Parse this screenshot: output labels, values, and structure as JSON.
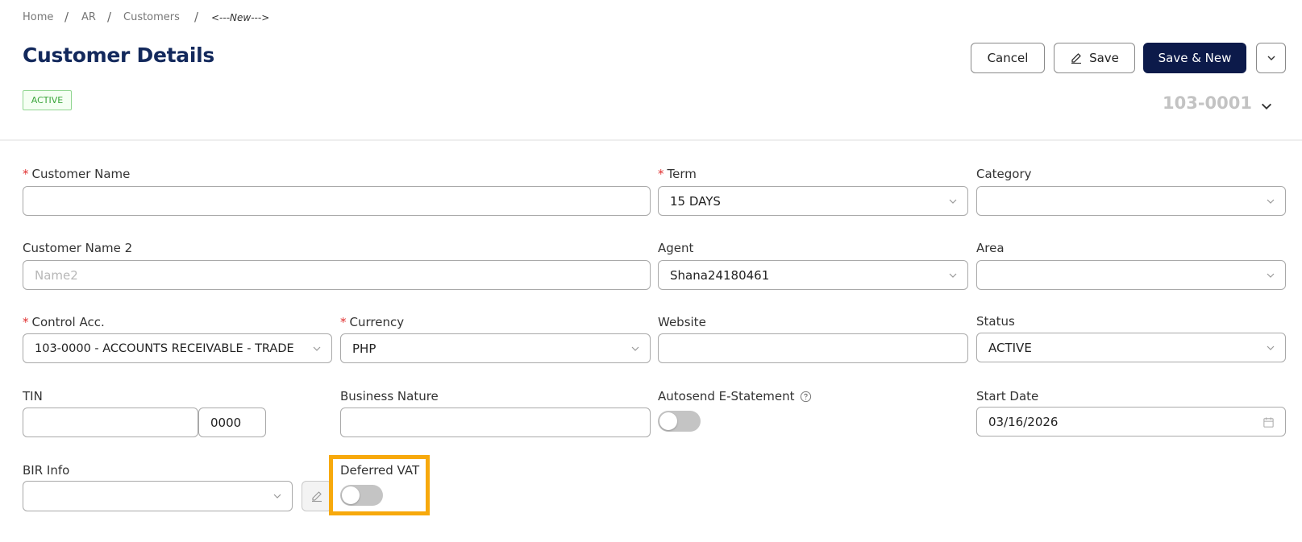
{
  "breadcrumb": {
    "home": "Home",
    "ar": "AR",
    "customers": "Customers",
    "current": "<---New--->",
    "separator": "/"
  },
  "header": {
    "title": "Customer Details",
    "status_badge": "ACTIVE",
    "document_number": "103-0001"
  },
  "toolbar": {
    "cancel_label": "Cancel",
    "save_label": "Save",
    "save_new_label": "Save & New"
  },
  "form": {
    "required_marker": "*",
    "customer_name": {
      "label": "Customer Name",
      "value": ""
    },
    "term": {
      "label": "Term",
      "value": "15 DAYS"
    },
    "category": {
      "label": "Category",
      "value": ""
    },
    "customer_name_2": {
      "label": "Customer Name 2",
      "placeholder": "Name2"
    },
    "agent": {
      "label": "Agent",
      "value": "Shana24180461"
    },
    "area": {
      "label": "Area",
      "value": ""
    },
    "control_acc": {
      "label": "Control Acc.",
      "value": "103-0000 - ACCOUNTS RECEIVABLE - TRADE"
    },
    "currency": {
      "label": "Currency",
      "value": "PHP"
    },
    "website": {
      "label": "Website",
      "value": ""
    },
    "status": {
      "label": "Status",
      "value": "ACTIVE"
    },
    "tin": {
      "label": "TIN",
      "value": "",
      "branch_code": "0000"
    },
    "business_nature": {
      "label": "Business Nature",
      "value": ""
    },
    "autosend": {
      "label": "Autosend E-Statement",
      "enabled": false
    },
    "start_date": {
      "label": "Start Date",
      "value": "03/16/2026"
    },
    "bir_info": {
      "label": "BIR Info",
      "value": ""
    },
    "deferred_vat": {
      "label": "Deferred VAT",
      "enabled": false
    }
  },
  "icons": {
    "edit": "pencil-icon",
    "dropdown": "chevron-down-icon",
    "calendar": "calendar-icon",
    "help": "question-circle-icon"
  },
  "colors": {
    "primary": "#0c1a4a",
    "title": "#13295c",
    "required": "#e03030",
    "badge_green": "#3aa53a",
    "highlight": "#f7a90c"
  }
}
